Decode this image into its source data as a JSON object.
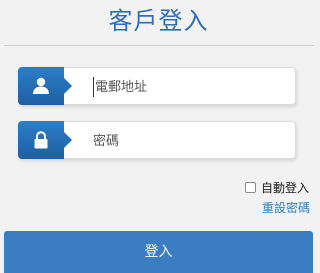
{
  "page": {
    "title": "客戶登入"
  },
  "form": {
    "email": {
      "placeholder": "電郵地址",
      "value": "",
      "icon": "user-icon"
    },
    "password": {
      "placeholder": "密碼",
      "value": "",
      "icon": "lock-icon"
    },
    "remember_label": "自動登入",
    "remember_checked": false,
    "reset_label": "重設密碼",
    "submit_label": "登入"
  },
  "colors": {
    "accent": "#2f6eb5",
    "icon_tab": "#2470b6",
    "button": "#3a7dc0",
    "link": "#2f7fbf",
    "background": "#f2f2f2"
  }
}
